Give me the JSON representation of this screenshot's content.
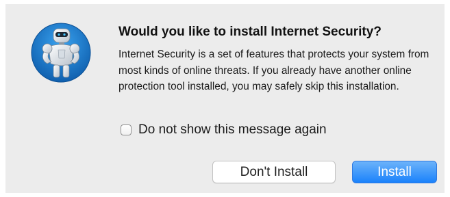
{
  "dialog": {
    "title": "Would you like to install Internet Security?",
    "message": "Internet Security is a set of features that protects your system from most kinds of online threats. If you already have another online protection tool installed, you may safely skip this installation.",
    "checkbox_label": "Do not show this message again",
    "checkbox_checked": false,
    "secondary_button_label": "Don't Install",
    "primary_button_label": "Install",
    "app_icon": "robot-app-icon"
  },
  "colors": {
    "dialog_background": "#ececec",
    "primary_button": "#1a82fb",
    "icon_background": "#1c7fd8"
  }
}
